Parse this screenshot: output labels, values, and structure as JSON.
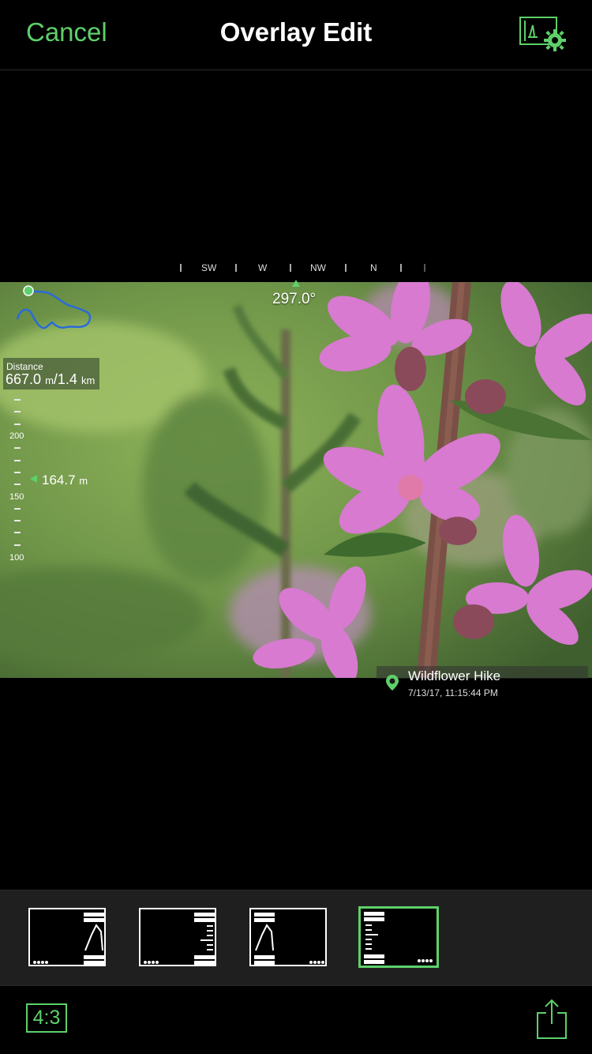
{
  "nav": {
    "cancel_label": "Cancel",
    "title": "Overlay Edit",
    "settings_icon": "overlay-settings-gear-icon"
  },
  "compass": {
    "labels": [
      "SW",
      "W",
      "NW",
      "N"
    ],
    "heading": "297.0°"
  },
  "overlay": {
    "distance_label": "Distance",
    "distance_value": "667.0",
    "distance_unit": "m",
    "distance_total": "/1.4",
    "distance_total_unit": "km",
    "altitude_value": "164.7",
    "altitude_unit": "m",
    "altitude_scale": [
      "200",
      "150",
      "100"
    ],
    "location_name": "Wildflower Hike",
    "location_datetime": "7/13/17, 11:15:44 PM"
  },
  "templates": {
    "count": 4,
    "selected_index": 3
  },
  "bottom": {
    "aspect_label": "4:3",
    "share_icon": "share-icon"
  },
  "colors": {
    "accent": "#5ed06a",
    "background": "#000000",
    "picker_background": "#1f1f1f"
  }
}
